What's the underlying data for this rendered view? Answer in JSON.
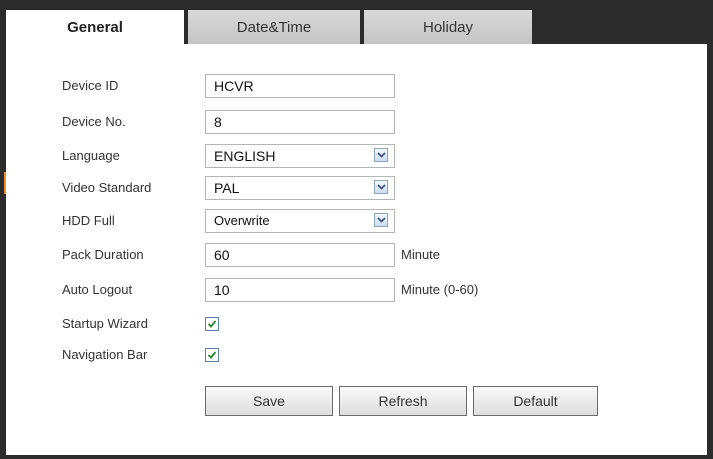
{
  "tabs": {
    "general": "General",
    "datetime": "Date&Time",
    "holiday": "Holiday"
  },
  "fields": {
    "device_id": {
      "label": "Device ID",
      "value": "HCVR"
    },
    "device_no": {
      "label": "Device No.",
      "value": "8"
    },
    "language": {
      "label": "Language",
      "value": "ENGLISH"
    },
    "video_standard": {
      "label": "Video Standard",
      "value": "PAL"
    },
    "hdd_full": {
      "label": "HDD Full",
      "value": "Overwrite"
    },
    "pack_duration": {
      "label": "Pack Duration",
      "value": "60",
      "unit": "Minute"
    },
    "auto_logout": {
      "label": "Auto Logout",
      "value": "10",
      "unit": "Minute (0-60)"
    },
    "startup_wizard": {
      "label": "Startup Wizard",
      "checked": true
    },
    "navigation_bar": {
      "label": "Navigation Bar",
      "checked": true
    }
  },
  "buttons": {
    "save": "Save",
    "refresh": "Refresh",
    "default": "Default"
  },
  "icons": {
    "dropdown": "chevron-down-icon",
    "check": "checkmark-icon"
  },
  "colors": {
    "frame": "#2b2b2b",
    "accent": "#e8902a",
    "check": "#2a8a2a"
  }
}
